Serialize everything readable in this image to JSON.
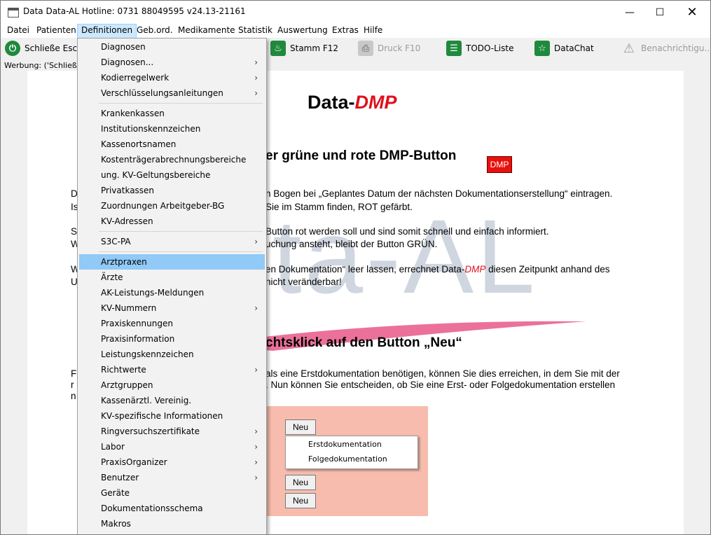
{
  "window": {
    "title": "Data Data-AL Hotline: 0731 88049595 v24.13-21161"
  },
  "menubar": [
    "Datei",
    "Patienten",
    "Definitionen",
    "Geb.ord.",
    "Medikamente",
    "Statistik",
    "Auswertung",
    "Extras",
    "Hilfe"
  ],
  "toolbar": {
    "close": "Schließe Esc",
    "stamm": "Stamm F12",
    "druck": "Druck F10",
    "todo": "TODO-Liste",
    "datachat": "DataChat",
    "benach": "Benachrichtigu..."
  },
  "werbung": "Werbung:   ('Schließe",
  "dropdown": [
    {
      "label": "Diagnosen",
      "arrow": ""
    },
    {
      "label": "Diagnosen...",
      "arrow": "›"
    },
    {
      "label": "Kodierregelwerk",
      "arrow": "›"
    },
    {
      "label": "Verschlüsselungsanleitungen",
      "arrow": "›"
    },
    {
      "label": "Krankenkassen",
      "arrow": ""
    },
    {
      "label": "Institutionskennzeichen",
      "arrow": ""
    },
    {
      "label": "Kassenortsnamen",
      "arrow": ""
    },
    {
      "label": "Kostenträgerabrechnungsbereiche",
      "arrow": ""
    },
    {
      "label": "ung. KV-Geltungsbereiche",
      "arrow": ""
    },
    {
      "label": "Privatkassen",
      "arrow": ""
    },
    {
      "label": "Zuordnungen Arbeitgeber-BG",
      "arrow": ""
    },
    {
      "label": "KV-Adressen",
      "arrow": ""
    },
    {
      "label": "S3C-PA",
      "arrow": "›"
    },
    {
      "label": "Arztpraxen",
      "arrow": ""
    },
    {
      "label": "Ärzte",
      "arrow": ""
    },
    {
      "label": "AK-Leistungs-Meldungen",
      "arrow": ""
    },
    {
      "label": "KV-Nummern",
      "arrow": "›"
    },
    {
      "label": "Praxiskennungen",
      "arrow": ""
    },
    {
      "label": "Praxisinformation",
      "arrow": ""
    },
    {
      "label": "Leistungskennzeichen",
      "arrow": ""
    },
    {
      "label": "Richtwerte",
      "arrow": "›"
    },
    {
      "label": "Arztgruppen",
      "arrow": ""
    },
    {
      "label": "Kassenärztl. Vereinig.",
      "arrow": ""
    },
    {
      "label": "KV-spezifische Informationen",
      "arrow": ""
    },
    {
      "label": "Ringversuchszertifikate",
      "arrow": "›"
    },
    {
      "label": "Labor",
      "arrow": "›"
    },
    {
      "label": "PraxisOrganizer",
      "arrow": "›"
    },
    {
      "label": "Benutzer",
      "arrow": "›"
    },
    {
      "label": "Geräte",
      "arrow": ""
    },
    {
      "label": "Dokumentationsschema",
      "arrow": ""
    },
    {
      "label": "Makros",
      "arrow": ""
    }
  ],
  "content": {
    "logo_a": "Data-",
    "logo_b": "DMP",
    "watermark": "ta-AL",
    "heading1": "er grüne und rote DMP-Button",
    "dmp_button": "DMP",
    "p1_l1": "n Bogen bei „Geplantes Datum der nächsten Dokumentationserstellung“ eintragen.",
    "p1_l2": "Sie im Stamm finden, ROT gefärbt.",
    "p2_l1": "Button rot werden soll und sind somit schnell und einfach informiert.",
    "p2_l2": "uchung ansteht, bleibt der Button GRÜN.",
    "p3_l1a": "en Dokumentation“ leer lassen, errechnet Data-",
    "p3_l1b": "DMP",
    "p3_l1c": " diesen Zeitpunkt anhand des",
    "p3_l2": "nicht veränderbar!",
    "heading2": "chtsklick auf den Button „Neu“",
    "p4_l1": "als eine Erstdokumentation benötigen, können Sie dies erreichen, in dem Sie mit der",
    "p4_l2": ". Nun können Sie entscheiden, ob Sie eine Erst- oder Folgedokumentation erstellen",
    "left_frag": [
      "D",
      "Is",
      "S",
      "W",
      "W",
      "U",
      "F",
      "r",
      "n"
    ],
    "neu": "Neu",
    "ctx_erst": "Erstdokumentation",
    "ctx_folge": "Folgedokumentation"
  },
  "colors": {
    "accent_red": "#e0101a",
    "highlight": "#91c9f7",
    "pink": "#f7bcad",
    "toolbar_green": "#1f8a3c"
  }
}
